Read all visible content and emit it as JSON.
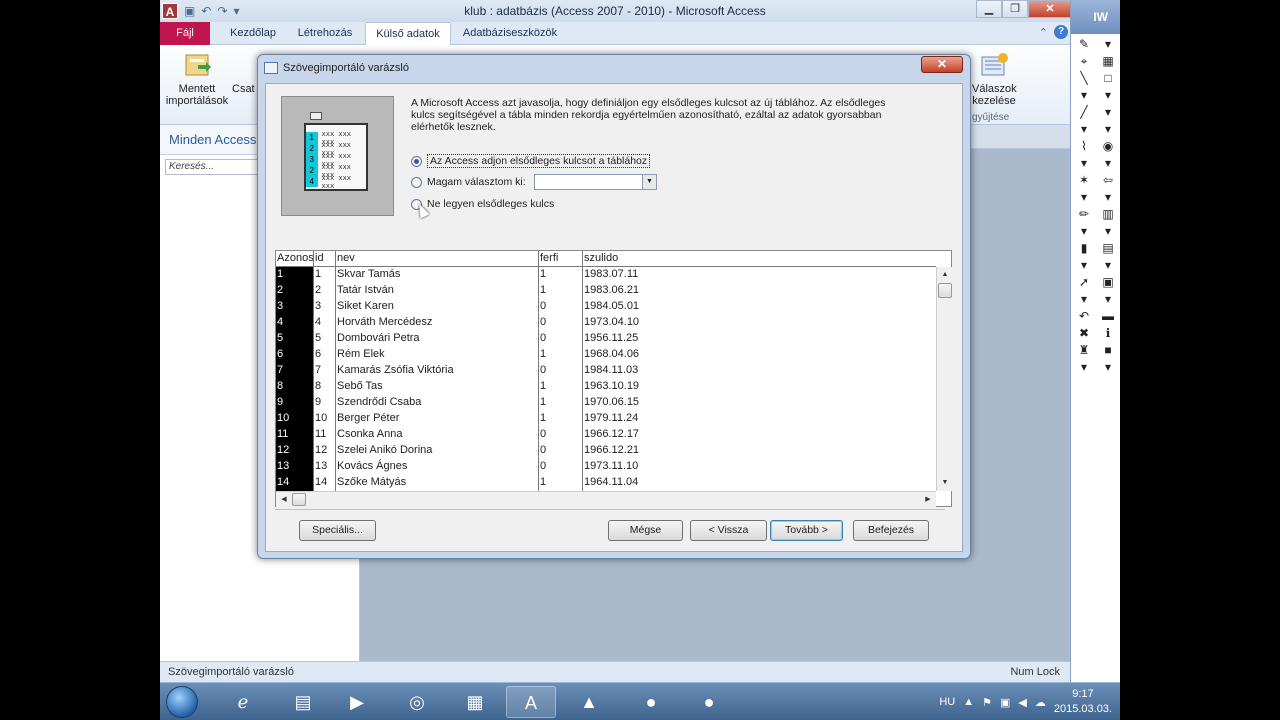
{
  "window": {
    "title": "klub : adatbázis (Access 2007 - 2010)  -  Microsoft Access",
    "app_letter": "A"
  },
  "tabs": [
    {
      "label": "Fájl"
    },
    {
      "label": "Kezdőlap"
    },
    {
      "label": "Létrehozás"
    },
    {
      "label": "Külső adatok"
    },
    {
      "label": "Adatbáziseszközök"
    }
  ],
  "ribbon": {
    "saved_imports_line1": "Mentett",
    "saved_imports_line2": "importálások",
    "partial_label": "Csat",
    "right_btn_line1": "Válaszok",
    "right_btn_line2": "kezelése",
    "right_group": "gyűjtése"
  },
  "nav": {
    "title": "Minden Access-",
    "search_placeholder": "Keresés..."
  },
  "status": {
    "left": "Szövegimportáló varázsló",
    "right": "Num Lock"
  },
  "iw": {
    "label": "IW"
  },
  "taskbar": {
    "lang": "HU",
    "time": "9:17",
    "date": "2015.03.03."
  },
  "dialog": {
    "title": "Szövegimportáló varázsló",
    "close_label": "✕",
    "description": "A Microsoft Access azt javasolja, hogy definiáljon egy elsődleges kulcsot az új táblához. Az elsődleges kulcs segítségével a tábla minden rekordja egyértelműen azonosítható, ezáltal az adatok gyorsabban elérhetők lesznek.",
    "options": [
      {
        "label": "Az Access adjon elsődleges kulcsot a táblához",
        "selected": true
      },
      {
        "label": "Magam választom ki:",
        "selected": false
      },
      {
        "label": "Ne legyen elsődleges kulcs",
        "selected": false
      }
    ],
    "picture_rows": [
      "1",
      "2",
      "3",
      "2",
      "4"
    ],
    "picture_cells": "xxx xxx xxx",
    "buttons": {
      "advanced": "Speciális...",
      "cancel": "Mégse",
      "back": "< Vissza",
      "next": "Tovább >",
      "finish": "Befejezés"
    },
    "table": {
      "columns": [
        "Azonosító",
        "id",
        "nev",
        "ferfi",
        "szulido"
      ],
      "rows": [
        [
          "1",
          "1",
          "Skvar Tamás",
          "1",
          "1983.07.11"
        ],
        [
          "2",
          "2",
          "Tatár István",
          "1",
          "1983.06.21"
        ],
        [
          "3",
          "3",
          "Siket Karen",
          "0",
          "1984.05.01"
        ],
        [
          "4",
          "4",
          "Horváth Mercédesz",
          "0",
          "1973.04.10"
        ],
        [
          "5",
          "5",
          "Dombovári Petra",
          "0",
          "1956.11.25"
        ],
        [
          "6",
          "6",
          "Rém Elek",
          "1",
          "1968.04.06"
        ],
        [
          "7",
          "7",
          "Kamarás Zsófia Viktória",
          "0",
          "1984.11.03"
        ],
        [
          "8",
          "8",
          "Sebő Tas",
          "1",
          "1963.10.19"
        ],
        [
          "9",
          "9",
          "Szendrődi Csaba",
          "1",
          "1970.06.15"
        ],
        [
          "10",
          "10",
          "Berger Péter",
          "1",
          "1979.11.24"
        ],
        [
          "11",
          "11",
          "Csonka Anna",
          "0",
          "1966.12.17"
        ],
        [
          "12",
          "12",
          "Szelei Anikó Dorina",
          "0",
          "1966.12.21"
        ],
        [
          "13",
          "13",
          "Kovács Ágnes",
          "0",
          "1973.11.10"
        ],
        [
          "14",
          "14",
          "Szőke Mátyás",
          "1",
          "1964.11.04"
        ]
      ]
    }
  }
}
